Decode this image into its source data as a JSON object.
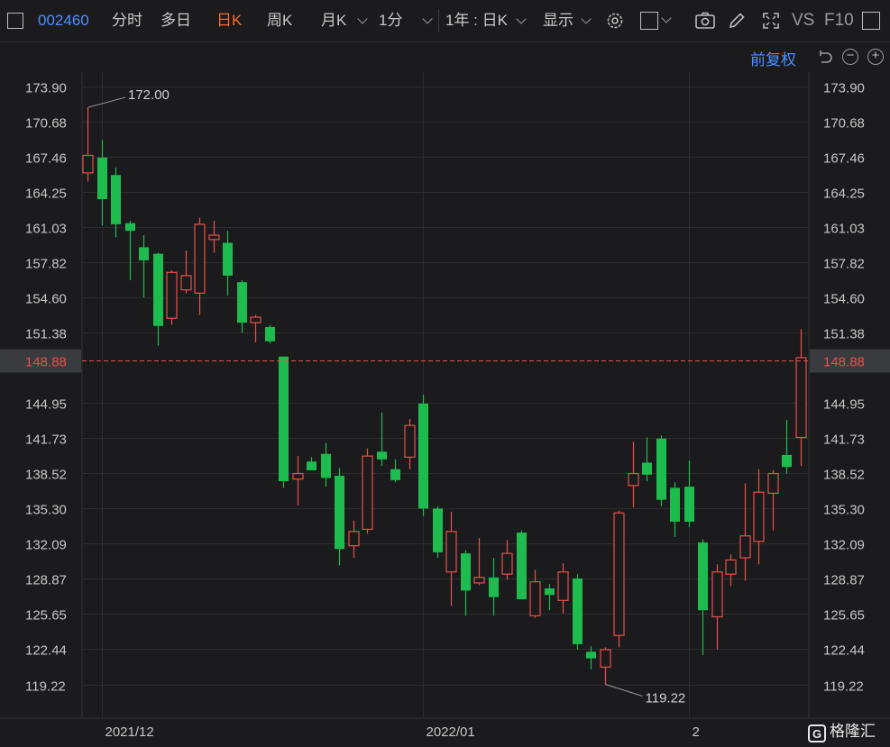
{
  "toolbar": {
    "code": "002460",
    "tabs": [
      {
        "label": "分时",
        "active": false
      },
      {
        "label": "多日",
        "active": false
      },
      {
        "label": "日K",
        "active": true
      },
      {
        "label": "周K",
        "active": false
      },
      {
        "label": "月K",
        "active": false
      },
      {
        "label": "1分",
        "active": false
      }
    ],
    "range_select": "1年 : 日K",
    "display_select": "显示",
    "vs_label": "VS",
    "f10_label": "F10"
  },
  "adjust_label": "前复权",
  "watermark": "格隆汇",
  "colors": {
    "up": "#e8504a",
    "down": "#1ebc4e",
    "price_line": "#e8504a",
    "accent": "#ff6a2b",
    "link": "#4c90ff"
  },
  "chart_data": {
    "type": "candlestick",
    "ylim": [
      117.6,
      175.5
    ],
    "y_ticks": [
      173.9,
      170.68,
      167.46,
      164.25,
      161.03,
      157.82,
      154.6,
      151.38,
      148.88,
      144.95,
      141.73,
      138.52,
      135.3,
      132.09,
      128.87,
      125.65,
      122.44,
      119.22
    ],
    "x_labels": [
      {
        "index": 1,
        "label": "2021/12"
      },
      {
        "index": 24,
        "label": "2022/01"
      },
      {
        "index": 43,
        "label": "2"
      }
    ],
    "current_price": 148.88,
    "annotations": [
      {
        "index": 0,
        "value": 172.0,
        "label": "172.00"
      },
      {
        "index": 37,
        "value": 119.22,
        "label": "119.22"
      }
    ],
    "candles": [
      {
        "o": 166.0,
        "h": 172.0,
        "l": 165.2,
        "c": 167.6
      },
      {
        "o": 167.4,
        "h": 169.0,
        "l": 161.2,
        "c": 163.6
      },
      {
        "o": 165.8,
        "h": 166.5,
        "l": 160.1,
        "c": 161.3
      },
      {
        "o": 161.4,
        "h": 161.6,
        "l": 156.2,
        "c": 160.7
      },
      {
        "o": 159.2,
        "h": 160.3,
        "l": 154.6,
        "c": 158.0
      },
      {
        "o": 158.6,
        "h": 158.7,
        "l": 150.2,
        "c": 152.0
      },
      {
        "o": 152.7,
        "h": 157.1,
        "l": 152.1,
        "c": 156.9
      },
      {
        "o": 155.3,
        "h": 158.9,
        "l": 155.0,
        "c": 156.6
      },
      {
        "o": 155.0,
        "h": 161.9,
        "l": 153.0,
        "c": 161.3
      },
      {
        "o": 159.9,
        "h": 161.6,
        "l": 158.7,
        "c": 160.3
      },
      {
        "o": 159.6,
        "h": 160.7,
        "l": 154.8,
        "c": 156.6
      },
      {
        "o": 156.0,
        "h": 156.2,
        "l": 151.4,
        "c": 152.3
      },
      {
        "o": 152.3,
        "h": 153.0,
        "l": 150.5,
        "c": 152.8
      },
      {
        "o": 151.9,
        "h": 152.1,
        "l": 150.4,
        "c": 150.6
      },
      {
        "o": 149.2,
        "h": 149.2,
        "l": 137.2,
        "c": 137.8
      },
      {
        "o": 138.0,
        "h": 140.1,
        "l": 135.6,
        "c": 138.5
      },
      {
        "o": 139.6,
        "h": 140.0,
        "l": 138.8,
        "c": 138.8
      },
      {
        "o": 140.3,
        "h": 141.3,
        "l": 137.3,
        "c": 138.1
      },
      {
        "o": 138.3,
        "h": 139.0,
        "l": 130.1,
        "c": 131.6
      },
      {
        "o": 131.9,
        "h": 134.2,
        "l": 130.8,
        "c": 133.2
      },
      {
        "o": 133.4,
        "h": 140.8,
        "l": 133.0,
        "c": 140.1
      },
      {
        "o": 140.5,
        "h": 144.1,
        "l": 139.2,
        "c": 139.8
      },
      {
        "o": 138.9,
        "h": 139.8,
        "l": 137.7,
        "c": 137.9
      },
      {
        "o": 140.0,
        "h": 143.5,
        "l": 138.9,
        "c": 142.9
      },
      {
        "o": 144.9,
        "h": 145.7,
        "l": 134.6,
        "c": 135.3
      },
      {
        "o": 135.3,
        "h": 135.5,
        "l": 130.8,
        "c": 131.3
      },
      {
        "o": 129.5,
        "h": 135.0,
        "l": 126.4,
        "c": 133.2
      },
      {
        "o": 131.2,
        "h": 131.5,
        "l": 125.5,
        "c": 127.8
      },
      {
        "o": 128.5,
        "h": 132.6,
        "l": 128.3,
        "c": 129.0
      },
      {
        "o": 129.0,
        "h": 130.8,
        "l": 125.5,
        "c": 127.2
      },
      {
        "o": 129.3,
        "h": 132.4,
        "l": 128.8,
        "c": 131.2
      },
      {
        "o": 133.1,
        "h": 133.3,
        "l": 127.0,
        "c": 127.0
      },
      {
        "o": 125.5,
        "h": 129.7,
        "l": 125.3,
        "c": 128.6
      },
      {
        "o": 128.0,
        "h": 128.4,
        "l": 126.0,
        "c": 127.4
      },
      {
        "o": 126.9,
        "h": 130.3,
        "l": 125.7,
        "c": 129.5
      },
      {
        "o": 128.9,
        "h": 129.3,
        "l": 122.4,
        "c": 122.9
      },
      {
        "o": 122.2,
        "h": 122.7,
        "l": 120.6,
        "c": 121.6
      },
      {
        "o": 120.8,
        "h": 122.6,
        "l": 119.22,
        "c": 122.4
      },
      {
        "o": 123.7,
        "h": 135.1,
        "l": 122.6,
        "c": 134.9
      },
      {
        "o": 137.4,
        "h": 141.4,
        "l": 135.4,
        "c": 138.5
      },
      {
        "o": 139.5,
        "h": 141.8,
        "l": 137.8,
        "c": 138.4
      },
      {
        "o": 141.7,
        "h": 142.0,
        "l": 135.5,
        "c": 136.1
      },
      {
        "o": 137.2,
        "h": 137.7,
        "l": 132.7,
        "c": 134.1
      },
      {
        "o": 137.3,
        "h": 139.7,
        "l": 133.6,
        "c": 134.1
      },
      {
        "o": 132.2,
        "h": 132.5,
        "l": 121.9,
        "c": 126.0
      },
      {
        "o": 125.4,
        "h": 130.2,
        "l": 122.4,
        "c": 129.5
      },
      {
        "o": 129.3,
        "h": 131.1,
        "l": 128.2,
        "c": 130.6
      },
      {
        "o": 130.8,
        "h": 137.6,
        "l": 128.7,
        "c": 132.8
      },
      {
        "o": 132.3,
        "h": 138.9,
        "l": 130.2,
        "c": 136.8
      },
      {
        "o": 136.7,
        "h": 138.8,
        "l": 133.3,
        "c": 138.5
      },
      {
        "o": 140.2,
        "h": 143.4,
        "l": 138.5,
        "c": 139.1
      },
      {
        "o": 141.8,
        "h": 151.7,
        "l": 139.2,
        "c": 149.1
      }
    ]
  }
}
